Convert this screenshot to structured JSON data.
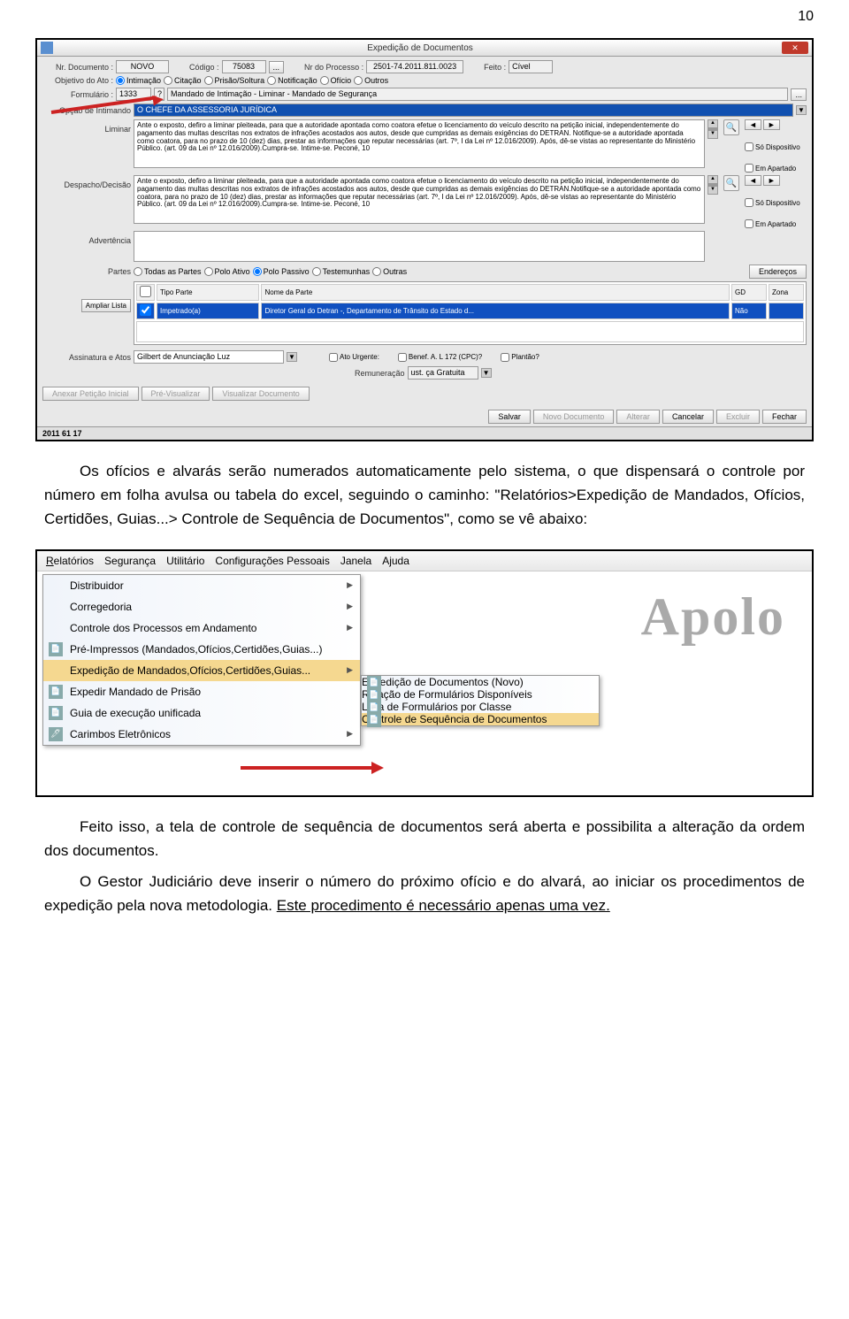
{
  "page_number": "10",
  "window1": {
    "title": "Expedição de Documentos",
    "labels": {
      "nr_documento": "Nr. Documento :",
      "codigo": "Código :",
      "nr_processo": "Nr do Processo :",
      "feito": "Feito :",
      "objetivo": "Objetivo do Ato :",
      "formulario": "Formulário :",
      "opcao_intimando": "Opção de Intimando",
      "liminar": "Liminar",
      "despacho": "Despacho/Decisão",
      "advertencia": "Advertência",
      "partes": "Partes",
      "ampliar_lista": "Ampliar Lista",
      "assinatura": "Assinatura e Atos",
      "remuneracao": "Remuneração"
    },
    "values": {
      "nr_documento": "NOVO",
      "codigo": "75083",
      "nr_processo": "2501-74.2011.811.0023",
      "feito": "Cível",
      "formulario_cod": "1333",
      "formulario_desc": "Mandado de Intimação - Liminar - Mandado de Segurança",
      "intimando": "O CHEFE DA ASSESSORIA JURÍDICA",
      "liminar_text": "Ante o exposto, defiro a liminar pleiteada, para que a autoridade apontada como coatora efetue o licenciamento do veículo descrito na petição inicial, independentemente do pagamento das multas descritas nos extratos de infrações acostados aos autos, desde que cumpridas as demais exigências do DETRAN. Notifique-se a autoridade apontada como coatora, para no prazo de 10 (dez) dias, prestar as informações que reputar necessárias (art. 7º, I da Lei nº 12.016/2009). Após, dê-se vistas ao representante do Ministério Público. (art. 09 da Lei nº 12.016/2009).Cumpra-se. Intime-se. Peconé, 10",
      "despacho_text": "Ante o exposto, defiro a liminar pleiteada, para que a autoridade apontada como coatora efetue o licenciamento do veículo descrito na petição inicial, independentemente do pagamento das multas descritas nos extratos de infrações acostados aos autos, desde que cumpridas as demais exigências do DETRAN.Notifique-se a autoridade apontada como coatora, para no prazo de 10 (dez) dias, prestar as informações que reputar necessárias (art. 7º, I da Lei nº 12.016/2009). Após, dê-se vistas ao representante do Ministério Público. (art. 09 da Lei nº 12.016/2009).Cumpra-se. Intime-se. Peconé, 10",
      "assinatura": "Gilbert de Anunciação Luz",
      "remuneracao": "ust. ça Gratuita"
    },
    "radios": {
      "intimacao": "Intimação",
      "citacao": "Citação",
      "prisao": "Prisão/Soltura",
      "notificacao": "Notificação",
      "oficio": "Ofício",
      "outros": "Outros",
      "todas_partes": "Todas as Partes",
      "polo_ativo": "Polo Ativo",
      "polo_passivo": "Polo Passivo",
      "testemunhas": "Testemunhas",
      "outras": "Outras"
    },
    "checks": {
      "so_disp": "Só Dispositivo",
      "em_apartado": "Em Apartado",
      "ato_urgente": "Ato Urgente:",
      "benef": "Benef. A. L 172 (CPC)?",
      "plantao": "Plantão?"
    },
    "table": {
      "h1": "Tipo Parte",
      "h2": "Nome da Parte",
      "h3": "GD",
      "h4": "Zona",
      "r1c1": "Impetrado(a)",
      "r1c2": "Diretor Geral do Detran -, Departamento de Trânsito do Estado d...",
      "r1c3": "Não",
      "r1c4": ""
    },
    "buttons": {
      "enderecos": "Endereços",
      "anexar": "Anexar Petição Inicial",
      "previsualizar": "Pré-Visualizar",
      "visualizar": "Visualizar Documento",
      "salvar": "Salvar",
      "novo": "Novo Documento",
      "alterar": "Alterar",
      "cancelar": "Cancelar",
      "excluir": "Excluir",
      "fechar": "Fechar"
    },
    "status": "2011 61 17"
  },
  "paragraph1a": "Os ofícios e alvarás serão numerados automaticamente pelo sistema, o que dispensará o controle por número em folha avulsa ou tabela do excel, seguindo o caminho: \"Relatórios>Expedição de Mandados, Ofícios, Certidões, Guias...> Controle de Sequência de Documentos\", como se vê abaixo:",
  "menu": {
    "bar": {
      "relatorios": "Relatórios",
      "seguranca": "Segurança",
      "utilitario": "Utilitário",
      "config": "Configurações Pessoais",
      "janela": "Janela",
      "ajuda": "Ajuda"
    },
    "items": {
      "distribuidor": "Distribuidor",
      "corregedoria": "Corregedoria",
      "controle_processos": "Controle dos Processos em Andamento",
      "pre_impressos": "Pré-Impressos (Mandados,Ofícios,Certidões,Guias...)",
      "expedicao": "Expedição de Mandados,Ofícios,Certidões,Guias...",
      "expedir_prisao": "Expedir Mandado de Prisão",
      "guia_exec": "Guia de execução unificada",
      "carimbos": "Carimbos Eletrônicos"
    },
    "submenu": {
      "exped_doc": "Expedição de Documentos (Novo)",
      "relacao": "Relação de Formulários Disponíveis",
      "lista": "Lista de Formulários por Classe",
      "controle_seq": "Controle de Sequência de Documentos"
    },
    "logo": "Apolo"
  },
  "paragraph2": "Feito isso, a tela de controle de sequência de documentos será aberta e possibilita a alteração da ordem dos documentos.",
  "paragraph3a": "O Gestor Judiciário deve inserir o número do próximo ofício e do alvará, ao iniciar os procedimentos de expedição pela nova metodologia. ",
  "paragraph3b": "Este procedimento é necessário apenas uma vez."
}
